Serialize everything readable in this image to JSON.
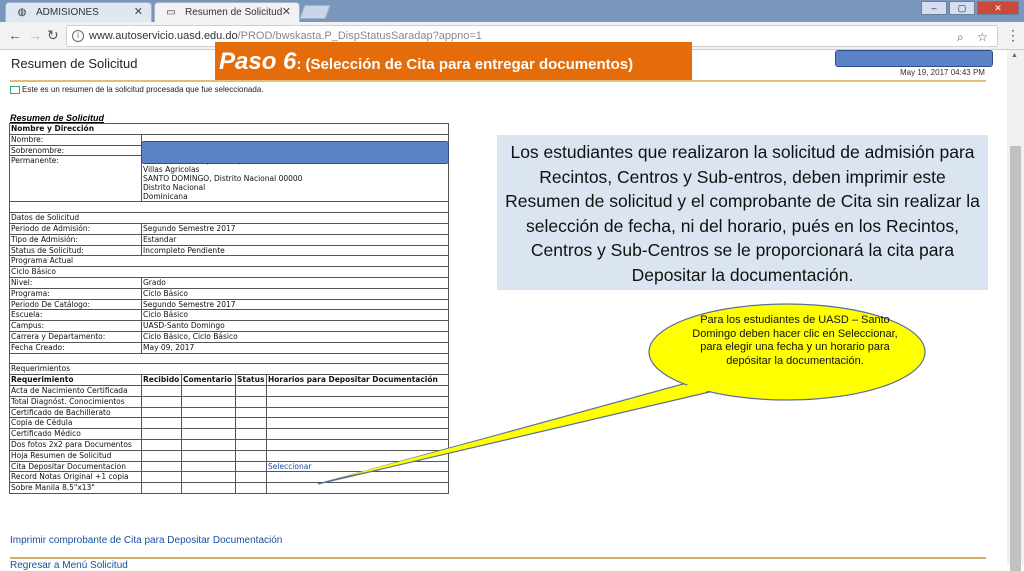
{
  "browser": {
    "tabs": [
      {
        "label": "ADMISIONES",
        "close": "✕"
      },
      {
        "label": "Resumen de Solicitud",
        "close": "✕"
      }
    ],
    "window_controls": [
      "–",
      "▢",
      "✕"
    ],
    "url_host": "www.autoservicio.uasd.edu.do",
    "url_path": "/PROD/bwskasta.P_DispStatusSaradap?appno=1"
  },
  "page": {
    "title": "Resumen de Solicitud",
    "date": "May 19, 2017 04:43 PM",
    "note": "Este es un resumen de la solicitud procesada que fue seleccionada.",
    "section_title": "Resumen de Solicitud"
  },
  "banner": {
    "paso": "Paso 6",
    "colon": ":",
    "subtitle": " (Selección de Cita para entregar documentos)"
  },
  "table": {
    "header_name": "Nombre y Dirección",
    "nombre_label": "Nombre:",
    "sobrenombre_label": "Sobrenombre:",
    "permanente_label": "Permanente:",
    "address_lines": [
      "Félix Evaristo mejia # 68 p/a",
      "Villas Agricolas",
      "SANTO DOMINGO, Distrito Nacional 00000",
      "Distrito Nacional",
      "Dominicana"
    ],
    "datos_title": "Datos de Solicitud",
    "datos": [
      {
        "label": "Periodo de Admisión:",
        "value": "Segundo Semestre 2017"
      },
      {
        "label": "Tipo de Admisión:",
        "value": "Estandar"
      },
      {
        "label": "Status de Solicitud:",
        "value": "Incompleto Pendiente"
      }
    ],
    "programa_actual": "Programa Actual",
    "ciclo_basico": "Ciclo Básico",
    "programa": [
      {
        "label": "Nivel:",
        "value": "Grado"
      },
      {
        "label": "Programa:",
        "value": "Ciclo Básico"
      },
      {
        "label": "Periodo De Catálogo:",
        "value": "Segundo Semestre 2017"
      },
      {
        "label": "Escuela:",
        "value": "Ciclo Básico"
      },
      {
        "label": "Campus:",
        "value": "UASD-Santo Domingo"
      },
      {
        "label": "Carrera y Departamento:",
        "value": "Ciclo Básico, Ciclo Básico"
      },
      {
        "label": "Fecha Creado:",
        "value": "May 09, 2017"
      }
    ],
    "req_title": "Requerimientos",
    "req_headers": [
      "Requerimiento",
      "Recibido",
      "Comentario",
      "Status",
      "Horarios para Depositar Documentación"
    ],
    "requirements": [
      "Acta de Nacimiento Certificada",
      "Total Diagnóst. Conocimientos",
      "Certificado de Bachillerato",
      "Copia de Cédula",
      "Certificado Médico",
      "Dos fotos 2x2 para Documentos",
      "Hoja Resumen de Solicitud",
      "Cita Depositar Documentacion",
      "Record Notas Original +1 copia",
      "Sobre Manila 8.5\"x13\""
    ],
    "seleccionar": "Seleccionar"
  },
  "callout": "Los estudiantes que realizaron la solicitud de admisión para Recintos, Centros y Sub-entros, deben imprimir este Resumen de solicitud y el comprobante  de Cita sin realizar la selección de fecha, ni del horario, pués en los Recintos, Centros y Sub-Centros se le proporcionará la cita para Depositar la documentación.",
  "bubble": "Para los estudiantes de UASD – Santo Domingo deben hacer clic en  Seleccionar, para elegir una fecha y un horario para depósitar la documentación.",
  "footer": {
    "print_link": "Imprimir comprobante de Cita para Depositar Documentación",
    "back_link": "Regresar a Menú Solicitud"
  },
  "colors": {
    "banner": "#e46c0a",
    "callout_bg": "#dbe4f1",
    "bubble": "#ffff00",
    "redaction": "#5b82c5"
  }
}
